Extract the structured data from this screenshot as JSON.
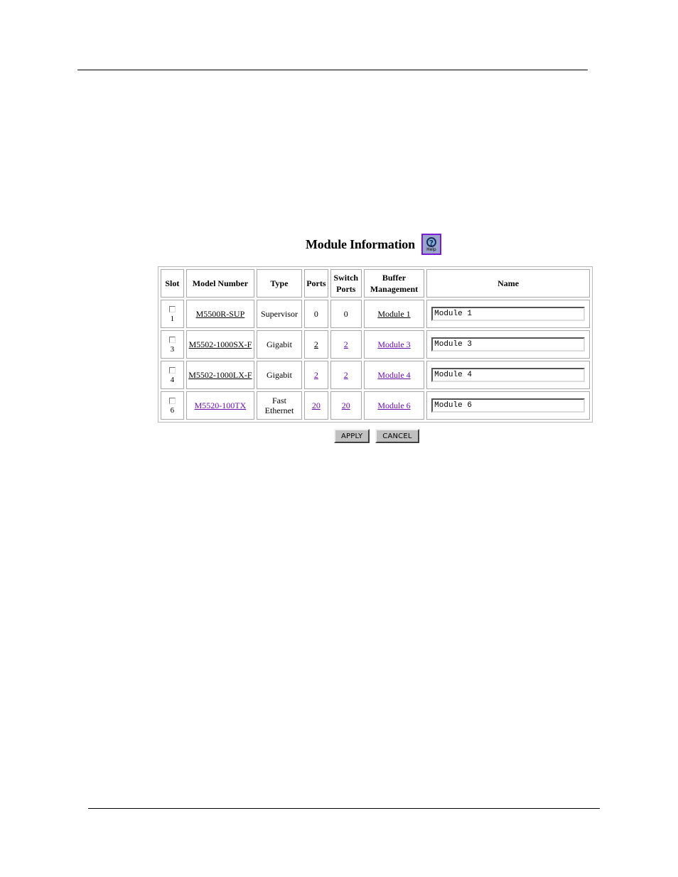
{
  "page": {
    "title": "Module Information",
    "help_label": "Help"
  },
  "table": {
    "headers": {
      "slot": "Slot",
      "model_number": "Model Number",
      "type": "Type",
      "ports": "Ports",
      "switch_ports_line1": "Switch",
      "switch_ports_line2": "Ports",
      "buffer_line1": "Buffer",
      "buffer_line2": "Management",
      "name": "Name"
    },
    "rows": [
      {
        "slot": "1",
        "model": "M5500R-SUP",
        "type_line1": "Supervisor",
        "type_line2": "",
        "ports": "0",
        "switch_ports": "0",
        "buffer": "Module 1",
        "name": "Module 1",
        "checked": false
      },
      {
        "slot": "3",
        "model": "M5502-1000SX-F",
        "type_line1": "Gigabit",
        "type_line2": "",
        "ports": "2",
        "switch_ports": "2",
        "buffer": "Module 3",
        "name": "Module 3",
        "checked": false
      },
      {
        "slot": "4",
        "model": "M5502-1000LX-F",
        "type_line1": "Gigabit",
        "type_line2": "",
        "ports": "2",
        "switch_ports": "2",
        "buffer": "Module 4",
        "name": "Module 4",
        "checked": false
      },
      {
        "slot": "6",
        "model": "M5520-100TX",
        "type_line1": "Fast",
        "type_line2": "Ethernet",
        "ports": "20",
        "switch_ports": "20",
        "buffer": "Module 6",
        "name": "Module 6",
        "checked": false
      }
    ]
  },
  "buttons": {
    "apply": "APPLY",
    "cancel": "CANCEL"
  },
  "colors": {
    "visited_link": "#6a0dad",
    "help_border": "#7a1cd6"
  }
}
